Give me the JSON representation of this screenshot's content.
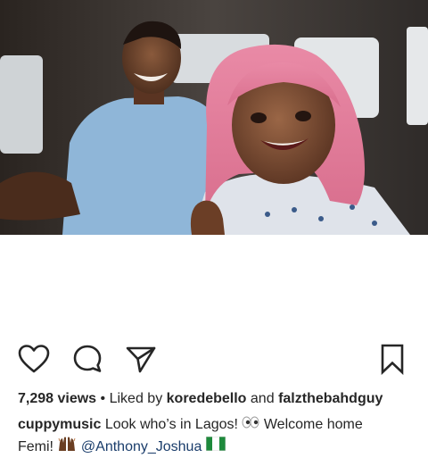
{
  "post": {
    "stats": {
      "views": "7,298 views",
      "separator": "•",
      "liked_by_prefix": "Liked by",
      "liked_user_1": "koredebello",
      "and": "and",
      "liked_user_2": "falzthebahdguy"
    },
    "caption": {
      "username": "cuppymusic",
      "text_1": "Look who’s in Lagos!",
      "text_2": "Welcome home",
      "text_3": "Femi!",
      "mention": "@Anthony_Joshua"
    },
    "icons": {
      "like": "heart-icon",
      "comment": "comment-bubble-icon",
      "share": "paper-plane-icon",
      "save": "bookmark-icon",
      "emoji_eyes": "eyes-emoji",
      "emoji_hands": "raised-hands-emoji",
      "emoji_flag": "nigeria-flag-emoji"
    },
    "colors": {
      "text": "#262626",
      "mention": "#1a3d6b",
      "flag_green": "#1e8a3c"
    }
  }
}
